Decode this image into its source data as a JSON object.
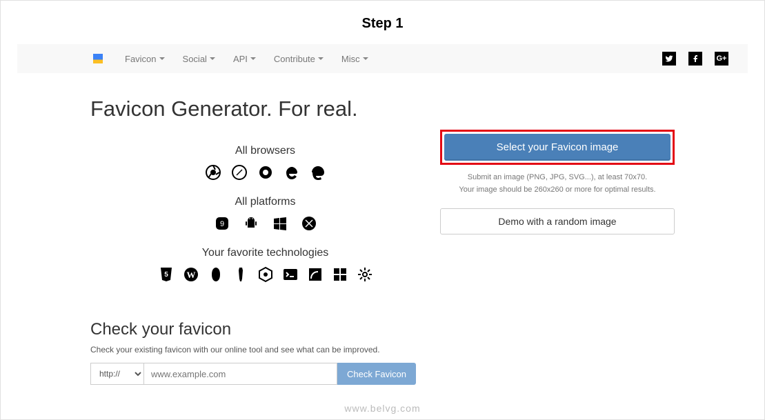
{
  "step_title": "Step 1",
  "nav": {
    "items": [
      "Favicon",
      "Social",
      "API",
      "Contribute",
      "Misc"
    ]
  },
  "hero": "Favicon Generator. For real.",
  "sections": {
    "browsers": "All browsers",
    "platforms": "All platforms",
    "tech": "Your favorite technologies"
  },
  "select_button": "Select your Favicon image",
  "hint1": "Submit an image (PNG, JPG, SVG...), at least 70x70.",
  "hint2": "Your image should be 260x260 or more for optimal results.",
  "demo_button": "Demo with a random image",
  "check": {
    "title": "Check your favicon",
    "desc": "Check your existing favicon with our online tool and see what can be improved.",
    "protocol": "http://",
    "placeholder": "www.example.com",
    "button": "Check Favicon"
  },
  "watermark": "www.belvg.com"
}
